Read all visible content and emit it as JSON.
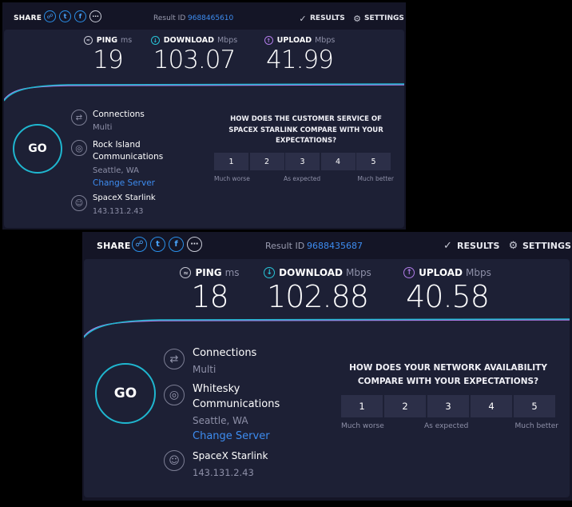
{
  "tests": [
    {
      "share_label": "SHARE",
      "result_label": "Result ID",
      "result_id": "9688465610",
      "results_label": "RESULTS",
      "settings_label": "SETTINGS",
      "ping": {
        "label": "PING",
        "unit": "ms",
        "value": "19"
      },
      "download": {
        "label": "DOWNLOAD",
        "unit": "Mbps",
        "value": "103.07"
      },
      "upload": {
        "label": "UPLOAD",
        "unit": "Mbps",
        "value": "41.99"
      },
      "go_label": "GO",
      "connections": {
        "title": "Connections",
        "value": "Multi"
      },
      "server": {
        "name_line1": "Rock Island",
        "name_line2": "Communications",
        "location": "Seattle, WA",
        "change_label": "Change Server"
      },
      "provider": {
        "name": "SpaceX Starlink",
        "ip": "143.131.2.43"
      },
      "survey": {
        "question_line1": "HOW DOES THE CUSTOMER SERVICE OF",
        "question_line2": "SPACEX STARLINK COMPARE WITH YOUR",
        "question_line3": "EXPECTATIONS?",
        "options": [
          "1",
          "2",
          "3",
          "4",
          "5"
        ],
        "low_label": "Much worse",
        "mid_label": "As expected",
        "high_label": "Much better"
      }
    },
    {
      "share_label": "SHARE",
      "result_label": "Result ID",
      "result_id": "9688435687",
      "results_label": "RESULTS",
      "settings_label": "SETTINGS",
      "ping": {
        "label": "PING",
        "unit": "ms",
        "value": "18"
      },
      "download": {
        "label": "DOWNLOAD",
        "unit": "Mbps",
        "value": "102.88"
      },
      "upload": {
        "label": "UPLOAD",
        "unit": "Mbps",
        "value": "40.58"
      },
      "go_label": "GO",
      "connections": {
        "title": "Connections",
        "value": "Multi"
      },
      "server": {
        "name_line1": "Whitesky",
        "name_line2": "Communications",
        "location": "Seattle, WA",
        "change_label": "Change Server"
      },
      "provider": {
        "name": "SpaceX Starlink",
        "ip": "143.131.2.43"
      },
      "survey": {
        "question_line1": "HOW DOES YOUR NETWORK AVAILABILITY",
        "question_line2": "COMPARE WITH YOUR EXPECTATIONS?",
        "options": [
          "1",
          "2",
          "3",
          "4",
          "5"
        ],
        "low_label": "Much worse",
        "mid_label": "As expected",
        "high_label": "Much better"
      }
    }
  ],
  "icons": {
    "ping": "ping-gauge-icon",
    "download": "download-arrow-icon",
    "upload": "upload-arrow-icon",
    "connections": "connections-arrows-icon",
    "server": "globe-icon",
    "provider": "user-icon",
    "share": [
      "link-icon",
      "twitter-icon",
      "facebook-icon",
      "more-icon"
    ],
    "results": "check-circle-icon",
    "settings": "gear-icon"
  },
  "colors": {
    "background": "#000000",
    "panel": "#141526",
    "card": "#1d2035",
    "accent_cyan": "#1fb6cf",
    "accent_purple": "#b07ce8",
    "link_blue": "#3d8cf0",
    "rating_button": "#2c2f48"
  }
}
